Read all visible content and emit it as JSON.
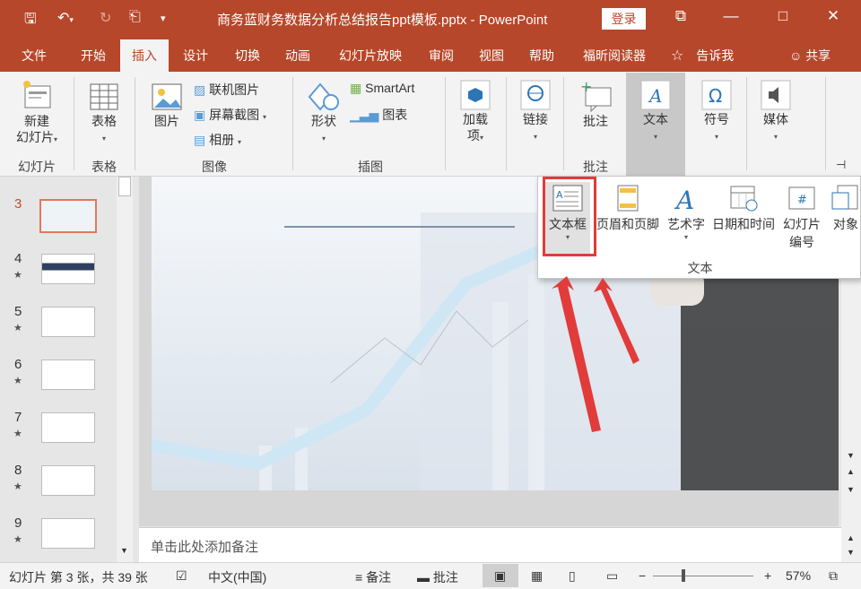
{
  "titlebar": {
    "filename_title": "商务蓝财务数据分析总结报告ppt模板.pptx  -  PowerPoint",
    "login_label": "登录"
  },
  "tabs": [
    "文件",
    "开始",
    "插入",
    "设计",
    "切换",
    "动画",
    "幻灯片放映",
    "审阅",
    "视图",
    "帮助",
    "福昕阅读器"
  ],
  "active_tab": "插入",
  "tellme": "告诉我",
  "share": "共享",
  "ribbon": {
    "new_slide": "新建",
    "new_slide2": "幻灯片",
    "group_slides": "幻灯片",
    "table": "表格",
    "group_tables": "表格",
    "picture": "图片",
    "online_pictures": "联机图片",
    "screenshot": "屏幕截图",
    "album": "相册",
    "group_images": "图像",
    "shapes": "形状",
    "smartart": "SmartArt",
    "chart": "图表",
    "group_illustrations": "插图",
    "addins": "加载",
    "addins2": "项",
    "link": "链接",
    "comment": "批注",
    "group_comments": "批注",
    "text": "文本",
    "symbols": "符号",
    "media": "媒体"
  },
  "slides": [
    {
      "num": "3",
      "star": false,
      "current": true
    },
    {
      "num": "4",
      "star": true,
      "current": false
    },
    {
      "num": "5",
      "star": true,
      "current": false
    },
    {
      "num": "6",
      "star": true,
      "current": false
    },
    {
      "num": "7",
      "star": true,
      "current": false
    },
    {
      "num": "8",
      "star": true,
      "current": false
    },
    {
      "num": "9",
      "star": true,
      "current": false
    }
  ],
  "dropdown": {
    "textbox": "文本框",
    "header_footer": "页眉和页脚",
    "wordart": "艺术字",
    "datetime": "日期和时间",
    "slide_number_1": "幻灯片",
    "slide_number_2": "编号",
    "object": "对象",
    "group_label": "文本"
  },
  "notes_placeholder": "单击此处添加备注",
  "status": {
    "slide_info": "幻灯片 第 3 张，共 39 张",
    "language": "中文(中国)",
    "notes": "备注",
    "comments": "批注",
    "zoom": "57%"
  },
  "colors": {
    "accent": "#b7472a",
    "highlight_box": "#e23b3b"
  }
}
